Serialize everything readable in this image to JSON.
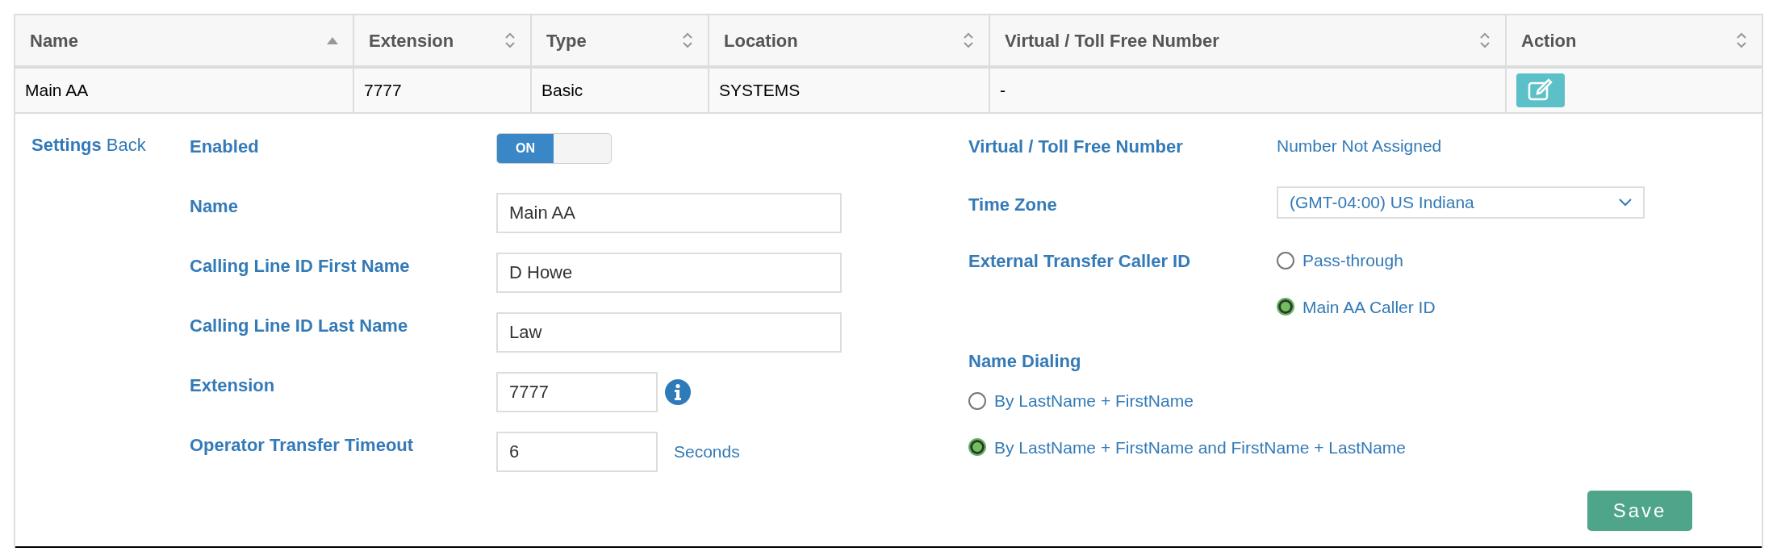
{
  "table": {
    "columns": [
      {
        "label": "Name",
        "sorted": true
      },
      {
        "label": "Extension",
        "sorted": false
      },
      {
        "label": "Type",
        "sorted": false
      },
      {
        "label": "Location",
        "sorted": false
      },
      {
        "label": "Virtual / Toll Free Number",
        "sorted": false
      },
      {
        "label": "Action",
        "sorted": false
      }
    ],
    "rows": [
      {
        "cells": [
          "Main AA",
          "7777",
          "Basic",
          "SYSTEMS",
          "-"
        ]
      }
    ]
  },
  "settings": {
    "title": "Settings",
    "back": "Back",
    "left": [
      {
        "kind": "toggle",
        "label": "Enabled",
        "on": true,
        "on_text": "ON"
      },
      {
        "kind": "text",
        "label": "Name",
        "value": "Main AA"
      },
      {
        "kind": "text",
        "label": "Calling Line ID First Name",
        "value": "D Howe"
      },
      {
        "kind": "text",
        "label": "Calling Line ID Last Name",
        "value": "Law"
      },
      {
        "kind": "short_info",
        "label": "Extension",
        "value": "7777"
      },
      {
        "kind": "short_unit",
        "label": "Operator Transfer Timeout",
        "value": "6",
        "unit": "Seconds"
      }
    ],
    "virtual": {
      "label": "Virtual / Toll Free Number",
      "value": "Number Not Assigned"
    },
    "time_zone": {
      "label": "Time Zone",
      "value": "(GMT-04:00) US Indiana"
    },
    "caller_id": {
      "label": "External Transfer Caller ID",
      "options": [
        {
          "label": "Pass-through",
          "selected": false
        },
        {
          "label": "Main AA Caller ID",
          "selected": true
        }
      ]
    },
    "name_dialing": {
      "label": "Name Dialing",
      "options": [
        {
          "label": "By LastName + FirstName",
          "selected": false
        },
        {
          "label": "By LastName + FirstName and FirstName + LastName",
          "selected": true
        }
      ]
    },
    "save": "Save"
  }
}
